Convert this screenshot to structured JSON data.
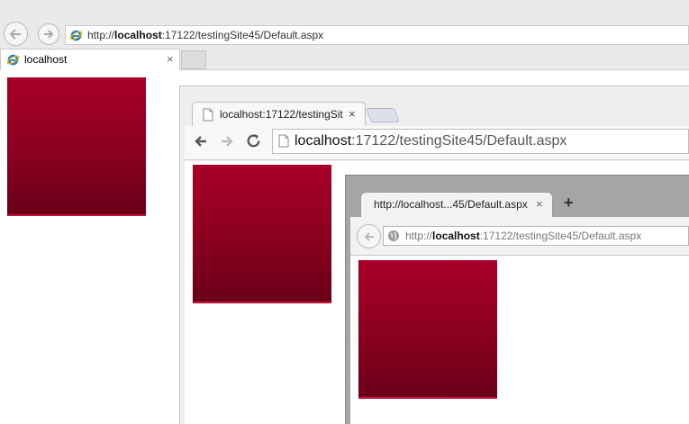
{
  "ie": {
    "address_prefix": "http://",
    "address_host": "localhost",
    "address_rest": ":17122/testingSite45/Default.aspx",
    "tab_title": "localhost",
    "tab_close": "×"
  },
  "chrome": {
    "tab_title": "localhost:17122/testingSit",
    "tab_close": "×",
    "address_host": "localhost",
    "address_rest": ":17122/testingSite45/Default.aspx"
  },
  "firefox": {
    "tab_title": "http://localhost...45/Default.aspx",
    "tab_close": "×",
    "new_tab": "+",
    "address_prefix": "http://",
    "address_host": "localhost",
    "address_rest": ":17122/testingSite45/Default.aspx"
  },
  "colors": {
    "box_top": "#a80028",
    "box_bottom": "#6a0018"
  }
}
